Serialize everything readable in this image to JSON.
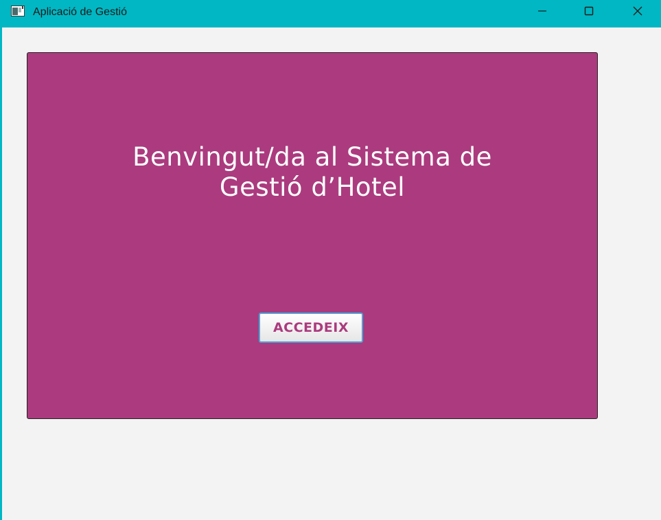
{
  "window": {
    "title": "Aplicació de Gestió",
    "accent_color": "#00b7c3",
    "background_color": "#f3f3f3"
  },
  "titlebar_controls": {
    "minimize_icon": "minimize-icon",
    "maximize_icon": "maximize-icon",
    "close_icon": "close-icon"
  },
  "welcome_panel": {
    "background_color": "#ab3b7e",
    "heading_line1": "Benvingut/da al Sistema de",
    "heading_line2": "Gestió d’Hotel",
    "access_button_label": "ACCEDEIX"
  }
}
